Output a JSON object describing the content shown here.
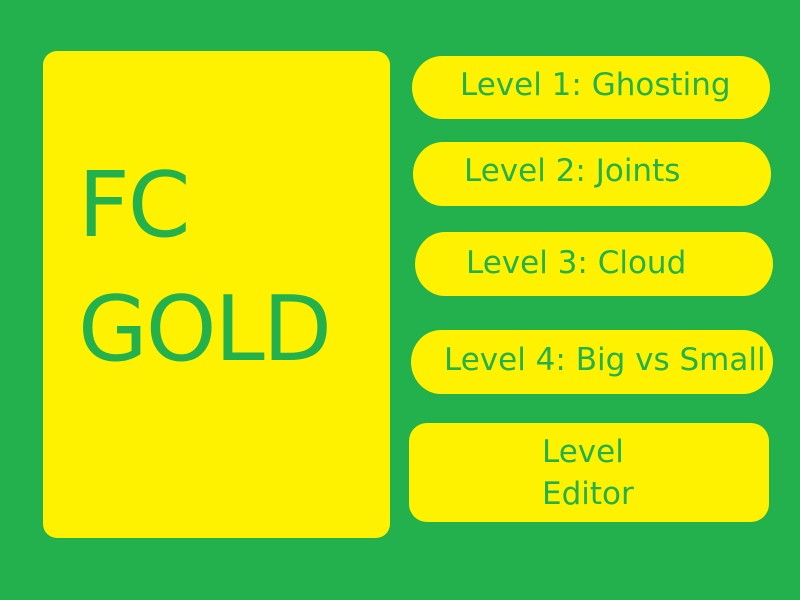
{
  "title": {
    "line1": "FC",
    "line2": "GOLD"
  },
  "menu": {
    "level1": "Level 1: Ghosting",
    "level2": "Level 2: Joints",
    "level3": "Level 3: Cloud",
    "level4": "Level 4: Big vs Small",
    "editor": "Level Editor"
  },
  "colors": {
    "background": "#22b14c",
    "panel": "#fff200",
    "text": "#22b14c"
  }
}
